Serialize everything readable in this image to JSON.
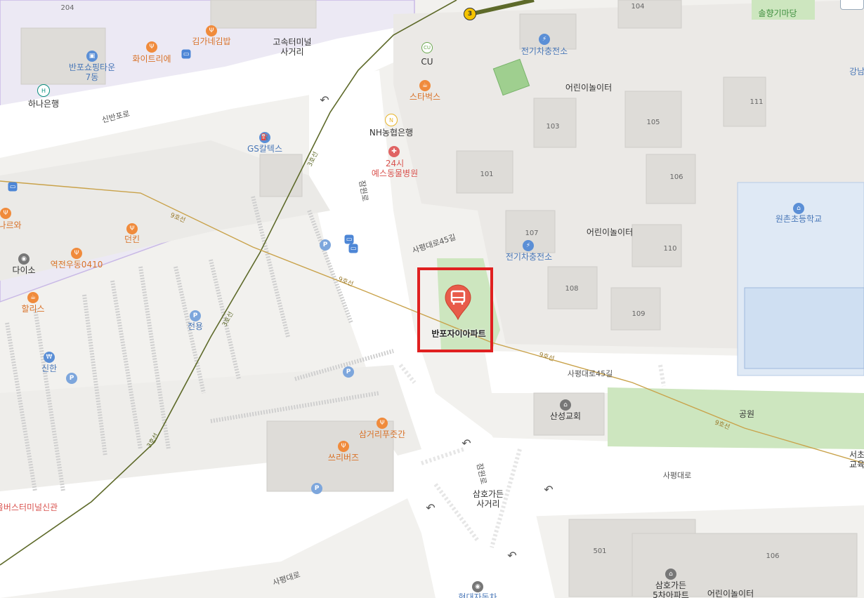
{
  "map": {
    "highlight_marker": {
      "label": "반포자이아파트",
      "icon": "bus-stop-icon"
    },
    "line_badge": "3",
    "subway_label": "9호선",
    "line3_label": "3호선",
    "places": {
      "hana_bank": "하나은행",
      "banpo_shopping": "반포쇼핑타운\n7동",
      "whitetree": "화이트리에",
      "kimga": "김가네김밥",
      "express_terminal_jct": "고속터미널\n사거리",
      "sinbanpo_ro": "신반포로",
      "gs_caltex": "GS칼텍스",
      "cu": "CU",
      "starbucks": "스타벅스",
      "nh_bank": "NH농협은행",
      "vet_24": "24시\n예스동물병원",
      "jamwon_ro": "잠원로",
      "jamwon_ro2": "잠원로",
      "sapyeong_45_1": "사평대로45길",
      "sapyeong_45_2": "사평대로45길",
      "sapyeong_1": "사평대로",
      "sapyeong_2": "사평대로",
      "ev_charge_1": "전기차충전소",
      "ev_charge_2": "전기차충전소",
      "playground_1": "어린이놀이터",
      "playground_2": "어린이놀이터",
      "playground_3": "어린이놀이터",
      "ninaro": "나르와",
      "dunkin": "던킨",
      "yeokjeon": "역전우동0410",
      "daiso": "다이소",
      "hollys": "할리스",
      "jeonyong": "전용",
      "sinhan": "신한",
      "samgeori": "삼거리푸줏간",
      "ssuribus": "쓰리버즈",
      "terminal_new": "울버스터미널신관",
      "samho_jct": "삼호가든\n사거리",
      "sansung_church": "산성교회",
      "park": "공원",
      "wonchon_school": "원촌초등학교",
      "songhyang": "솔향기마당",
      "gangnam": "강남",
      "seocho": "서초\n교육",
      "samho_5": "삼호가든\n5차아파트",
      "hyundai": "현대자동차"
    },
    "buildings": [
      "204",
      "104",
      "111",
      "103",
      "105",
      "101",
      "106",
      "107",
      "110",
      "108",
      "109",
      "501",
      "106"
    ]
  }
}
